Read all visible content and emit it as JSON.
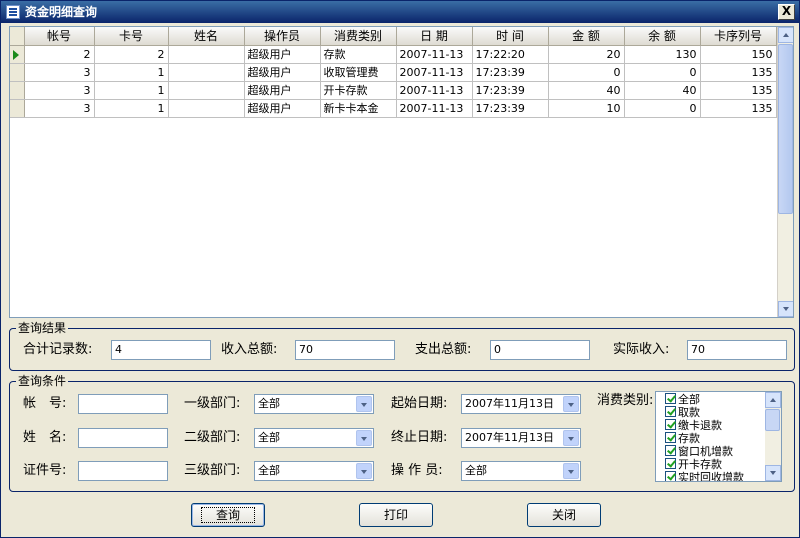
{
  "window": {
    "title": "资金明细查询",
    "close": "X"
  },
  "grid": {
    "columns": [
      "帐号",
      "卡号",
      "姓名",
      "操作员",
      "消费类别",
      "日 期",
      "时 间",
      "金 额",
      "余 额",
      "卡序列号"
    ],
    "rows": [
      [
        "2",
        "2",
        "",
        "超级用户",
        "存款",
        "2007-11-13",
        "17:22:20",
        "20",
        "130",
        "150"
      ],
      [
        "3",
        "1",
        "",
        "超级用户",
        "收取管理费",
        "2007-11-13",
        "17:23:39",
        "0",
        "0",
        "135"
      ],
      [
        "3",
        "1",
        "",
        "超级用户",
        "开卡存款",
        "2007-11-13",
        "17:23:39",
        "40",
        "40",
        "135"
      ],
      [
        "3",
        "1",
        "",
        "超级用户",
        "新卡卡本金",
        "2007-11-13",
        "17:23:39",
        "10",
        "0",
        "135"
      ]
    ]
  },
  "results": {
    "legend": "查询结果",
    "record_count_label": "合计记录数:",
    "record_count": "4",
    "income_label": "收入总额:",
    "income": "70",
    "expense_label": "支出总额:",
    "expense": "0",
    "actual_label": "实际收入:",
    "actual": "70"
  },
  "conditions": {
    "legend": "查询条件",
    "account_label": "帐　号:",
    "name_label": "姓　名:",
    "id_label": "证件号:",
    "dept1_label": "一级部门:",
    "dept1_value": "全部",
    "dept2_label": "二级部门:",
    "dept2_value": "全部",
    "dept3_label": "三级部门:",
    "dept3_value": "全部",
    "start_label": "起始日期:",
    "start_value": "2007年11月13日",
    "end_label": "终止日期:",
    "end_value": "2007年11月13日",
    "operator_label": "操 作 员:",
    "operator_value": "全部",
    "category_label": "消费类别:",
    "categories": [
      "全部",
      "取款",
      "缴卡退款",
      "存款",
      "窗口机增款",
      "开卡存款",
      "实时回收增款"
    ]
  },
  "buttons": {
    "query": "查询",
    "print": "打印",
    "close": "关闭"
  }
}
